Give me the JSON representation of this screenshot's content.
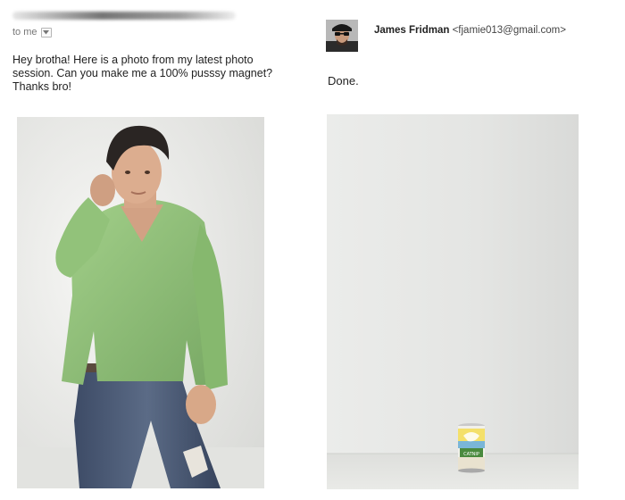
{
  "email_left": {
    "to_label": "to me",
    "dropdown_icon": "chevron-down-icon",
    "message_lines": [
      "Hey brotha! Here is a photo from my latest photo",
      "session. Can you make me a 100% pusssy magnet?",
      "Thanks bro!"
    ],
    "photo": "Young man in a green sweater and ripped jeans posing against a white backdrop"
  },
  "email_right": {
    "sender_name": "James Fridman",
    "sender_email": "<fjamie013@gmail.com>",
    "reply": "Done.",
    "photo": "Empty white studio corner with a small can of cat food on the floor",
    "can_label": "CATNIP"
  }
}
